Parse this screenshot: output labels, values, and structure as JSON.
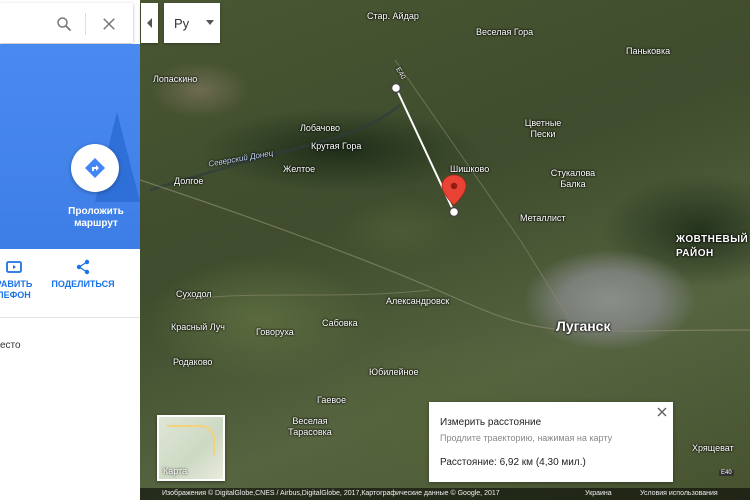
{
  "search": {
    "value": "",
    "placeholder": ""
  },
  "left_panel": {
    "route_label": "Проложить маршрут",
    "send_action_label": "ОТПРАВИТЬ НА ТЕЛЕФОН",
    "send_action_visible": "РАВИТЬ ЛЕФОН",
    "share_action_label": "ПОДЕЛИТЬСЯ",
    "place_text": "есто"
  },
  "controls": {
    "language": "Ру"
  },
  "map": {
    "labels": {
      "star_aidar": "Стар. Айдар",
      "veselaya_gora": "Веселая Гора",
      "pankovka": "Паньковка",
      "lopaskino": "Лопаскино",
      "lobachovo": "Лобачово",
      "krutaya_gora": "Крутая Гора",
      "zheltoe": "Желтое",
      "dolgoe": "Долгое",
      "seversky_donets": "Северский Донец",
      "tsvetnye_peski": "Цветные Пески",
      "shishkovo": "Шишково",
      "stukalova_balka": "Стукалова Балка",
      "metallist": "Металлист",
      "zhovtnevy_rayon": "ЖОВТНЕВЫЙ РАЙОН",
      "sukhodol": "Суходол",
      "alexandrovsk": "Александровск",
      "krasny_luch": "Красный Луч",
      "govoruha": "Говоруха",
      "sabovka": "Сабовка",
      "lugansk": "Луганск",
      "rodakovo": "Родаково",
      "yubileynoe": "Юбилейное",
      "gaevoe": "Гаевое",
      "veselaya_tarasovka": "Веселая Тарасовка",
      "khryashche": "Хрящеват",
      "road_e40_top": "Е40",
      "road_e40": "E40"
    }
  },
  "map_type": {
    "label": "Карта"
  },
  "measure": {
    "title": "Измерить расстояние",
    "hint": "Продлите траекторию, нажимая на карту",
    "distance": "Расстояние: 6,92 км (4,30 мил.)"
  },
  "footer": {
    "credits": "Изображения © DigitalGlobe,CNES / Airbus,DigitalGlobe, 2017,Картографические данные © Google, 2017",
    "country": "Украина",
    "terms": "Условия использования"
  },
  "colors": {
    "accent": "#4285f4",
    "pin": "#ea4335",
    "action_blue": "#1a73e8"
  }
}
